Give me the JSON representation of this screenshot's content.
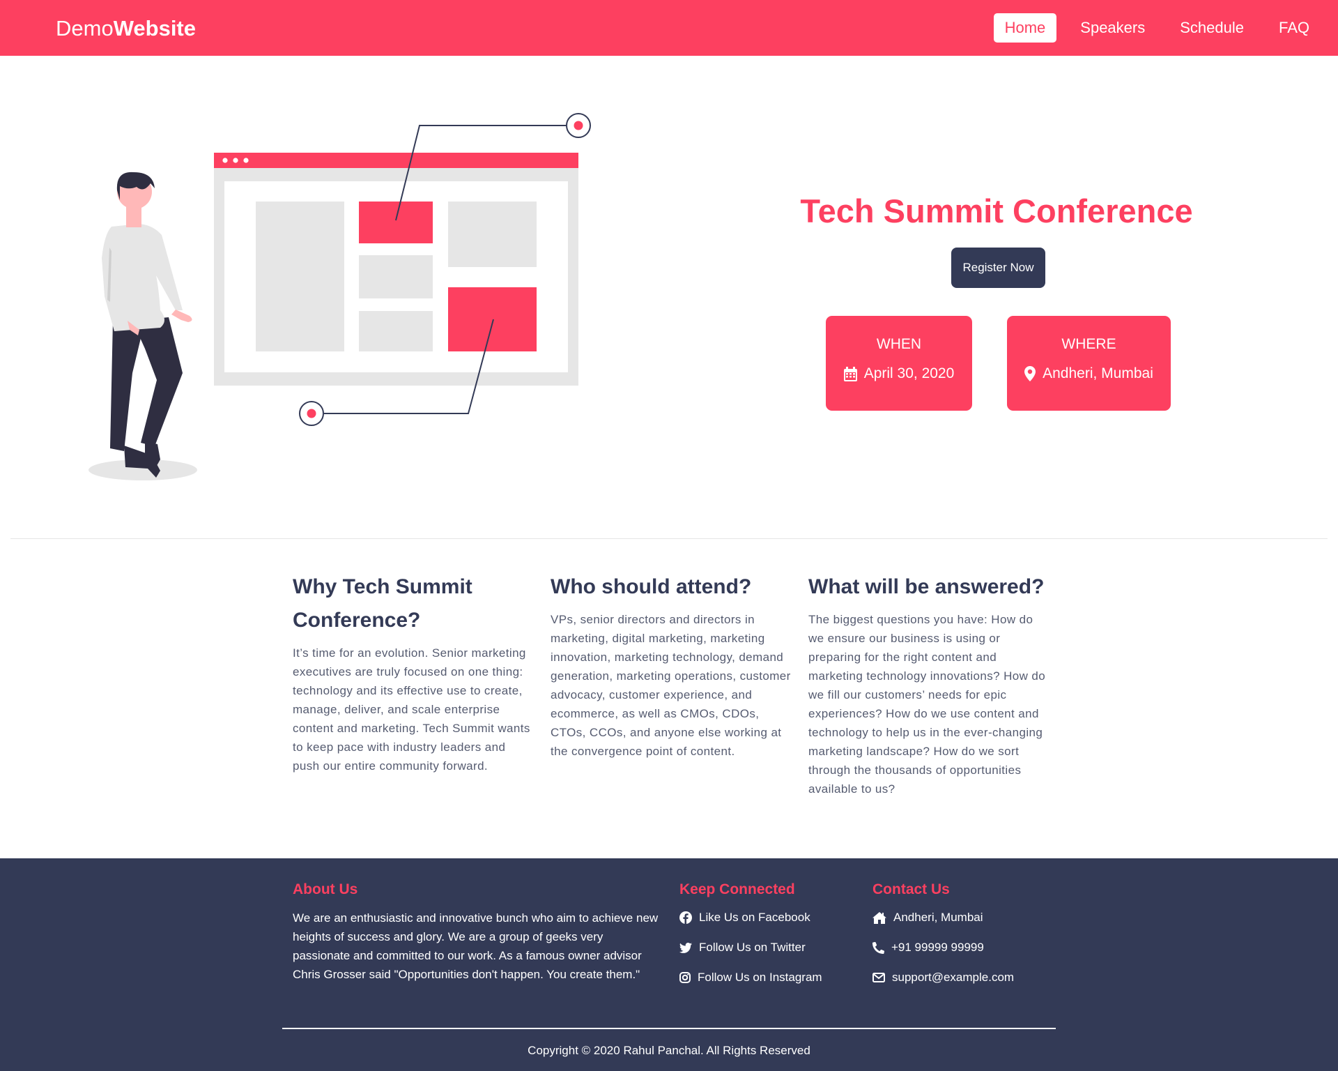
{
  "brand": {
    "prefix": "Demo",
    "bold": "Website"
  },
  "nav": {
    "items": [
      "Home",
      "Speakers",
      "Schedule",
      "FAQ"
    ],
    "active": "Home"
  },
  "hero": {
    "title": "Tech Summit Conference",
    "register_label": "Register Now",
    "when": {
      "label": "WHEN",
      "value": "April 30, 2020",
      "icon": "calendar-icon"
    },
    "where": {
      "label": "WHERE",
      "value": "Andheri, Mumbai",
      "icon": "map-pin-icon"
    }
  },
  "features": [
    {
      "title": "Why Tech Summit Conference?",
      "text": "It’s time for an evolution. Senior marketing executives are truly focused on one thing: technology and its effective use to create, manage, deliver, and scale enterprise content and marketing. Tech Summit wants to keep pace with industry leaders and push our entire community forward."
    },
    {
      "title": "Who should attend?",
      "text": "VPs, senior directors and directors in marketing, digital marketing, marketing innovation, marketing technology, demand generation, marketing operations, customer advocacy, customer experience, and ecommerce, as well as CMOs, CDOs, CTOs, CCOs, and anyone else working at the convergence point of content."
    },
    {
      "title": "What will be answered?",
      "text": "The biggest questions you have: How do we ensure our business is using or preparing for the right content and marketing technology innovations? How do we fill our customers’ needs for epic experiences? How do we use content and technology to help us in the ever-changing marketing landscape? How do we sort through the thousands of opportunities available to us?"
    }
  ],
  "footer": {
    "about": {
      "title": "About Us",
      "text": "We are an enthusiastic and innovative bunch who aim to achieve new heights of success and glory. We are a group of geeks very passionate and committed to our work. As a famous owner advisor Chris Grosser said \"Opportunities don't happen. You create them.\""
    },
    "connect": {
      "title": "Keep Connected",
      "links": [
        {
          "label": "Like Us on Facebook",
          "icon": "facebook-icon"
        },
        {
          "label": "Follow Us on Twitter",
          "icon": "twitter-icon"
        },
        {
          "label": "Follow Us on Instagram",
          "icon": "instagram-icon"
        }
      ]
    },
    "contact": {
      "title": "Contact Us",
      "items": [
        {
          "label": "Andheri, Mumbai",
          "icon": "home-icon"
        },
        {
          "label": "+91 99999 99999",
          "icon": "phone-icon"
        },
        {
          "label": "support@example.com",
          "icon": "envelope-icon"
        }
      ]
    },
    "copyright": "Copyright © 2020 Rahul Panchal. All Rights Reserved"
  },
  "colors": {
    "accent": "#fd4060",
    "dark": "#333a56",
    "light_gray": "#e6e6e6"
  }
}
